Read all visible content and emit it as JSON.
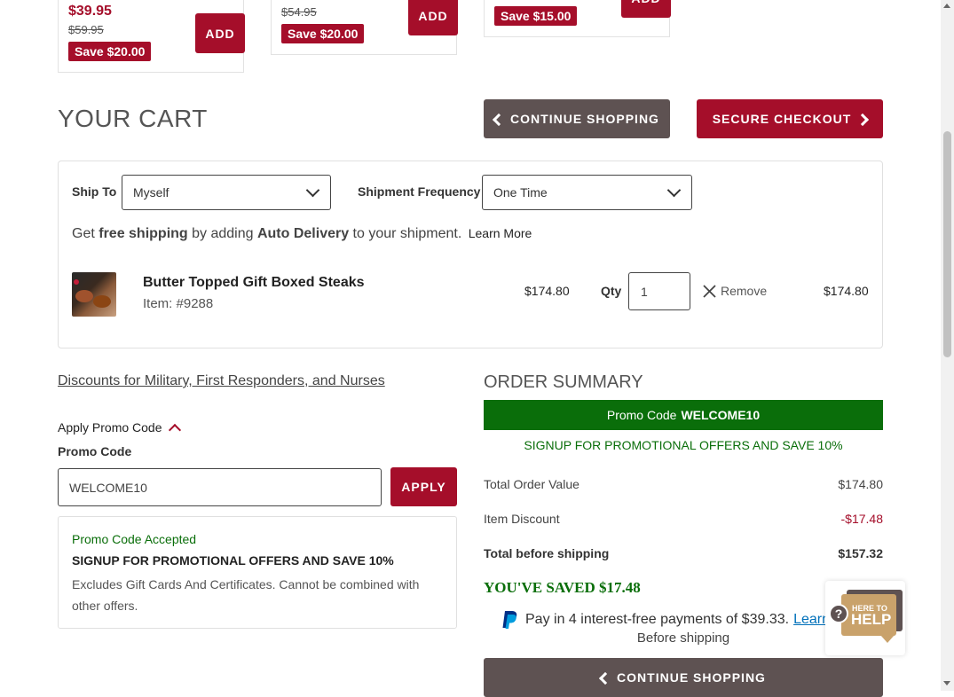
{
  "products": [
    {
      "price": "$39.95",
      "was": "$59.95",
      "save": "Save $20.00",
      "add": "ADD"
    },
    {
      "was": "$54.95",
      "save": "Save $20.00",
      "add": "ADD"
    },
    {
      "save": "Save $15.00",
      "add": "ADD"
    }
  ],
  "cart": {
    "title": "YOUR CART",
    "continue_label": "CONTINUE SHOPPING",
    "checkout_label": "SECURE CHECKOUT",
    "ship_to_label": "Ship To",
    "ship_to_value": "Myself",
    "frequency_label": "Shipment Frequency",
    "frequency_value": "One Time",
    "promo_line": {
      "prefix": "Get ",
      "free": "free shipping",
      "mid": " by adding ",
      "auto": "Auto Delivery",
      "suffix": " to your shipment.",
      "learn": "Learn More"
    },
    "item": {
      "name": "Butter Topped Gift Boxed Steaks",
      "number": "Item: #9288",
      "unit_price": "$174.80",
      "qty_label": "Qty",
      "qty": "1",
      "remove": "Remove",
      "total": "$174.80"
    }
  },
  "discounts_link": "Discounts for Military, First Responders, and Nurses",
  "promo": {
    "toggle_label": "Apply Promo Code",
    "field_label": "Promo Code",
    "value": "WELCOME10",
    "apply": "APPLY",
    "accepted": "Promo Code Accepted",
    "offer": "SIGNUP FOR PROMOTIONAL OFFERS AND SAVE 10%",
    "terms": "Excludes Gift Cards And Certificates. Cannot be combined with other offers."
  },
  "summary": {
    "title": "ORDER SUMMARY",
    "banner_label": "Promo Code",
    "banner_code": "WELCOME10",
    "signup": "SIGNUP FOR PROMOTIONAL OFFERS AND SAVE 10%",
    "rows": [
      {
        "label": "Total Order Value",
        "value": "$174.80"
      },
      {
        "label": "Item Discount",
        "value": "-$17.48"
      },
      {
        "label": "Total before shipping",
        "value": "$157.32"
      }
    ],
    "saved": "YOU'VE SAVED $17.48",
    "paypal_text": "Pay in 4 interest-free payments of $39.33.",
    "paypal_learn": "Learn",
    "paypal_sub": "Before shipping",
    "continue_label": "CONTINUE SHOPPING"
  },
  "help": {
    "top": "HERE TO",
    "main": "HELP",
    "q": "?"
  },
  "colors": {
    "brand_red": "#a50e2a",
    "gray_button": "#5e5252",
    "green": "#0a6e0a"
  }
}
